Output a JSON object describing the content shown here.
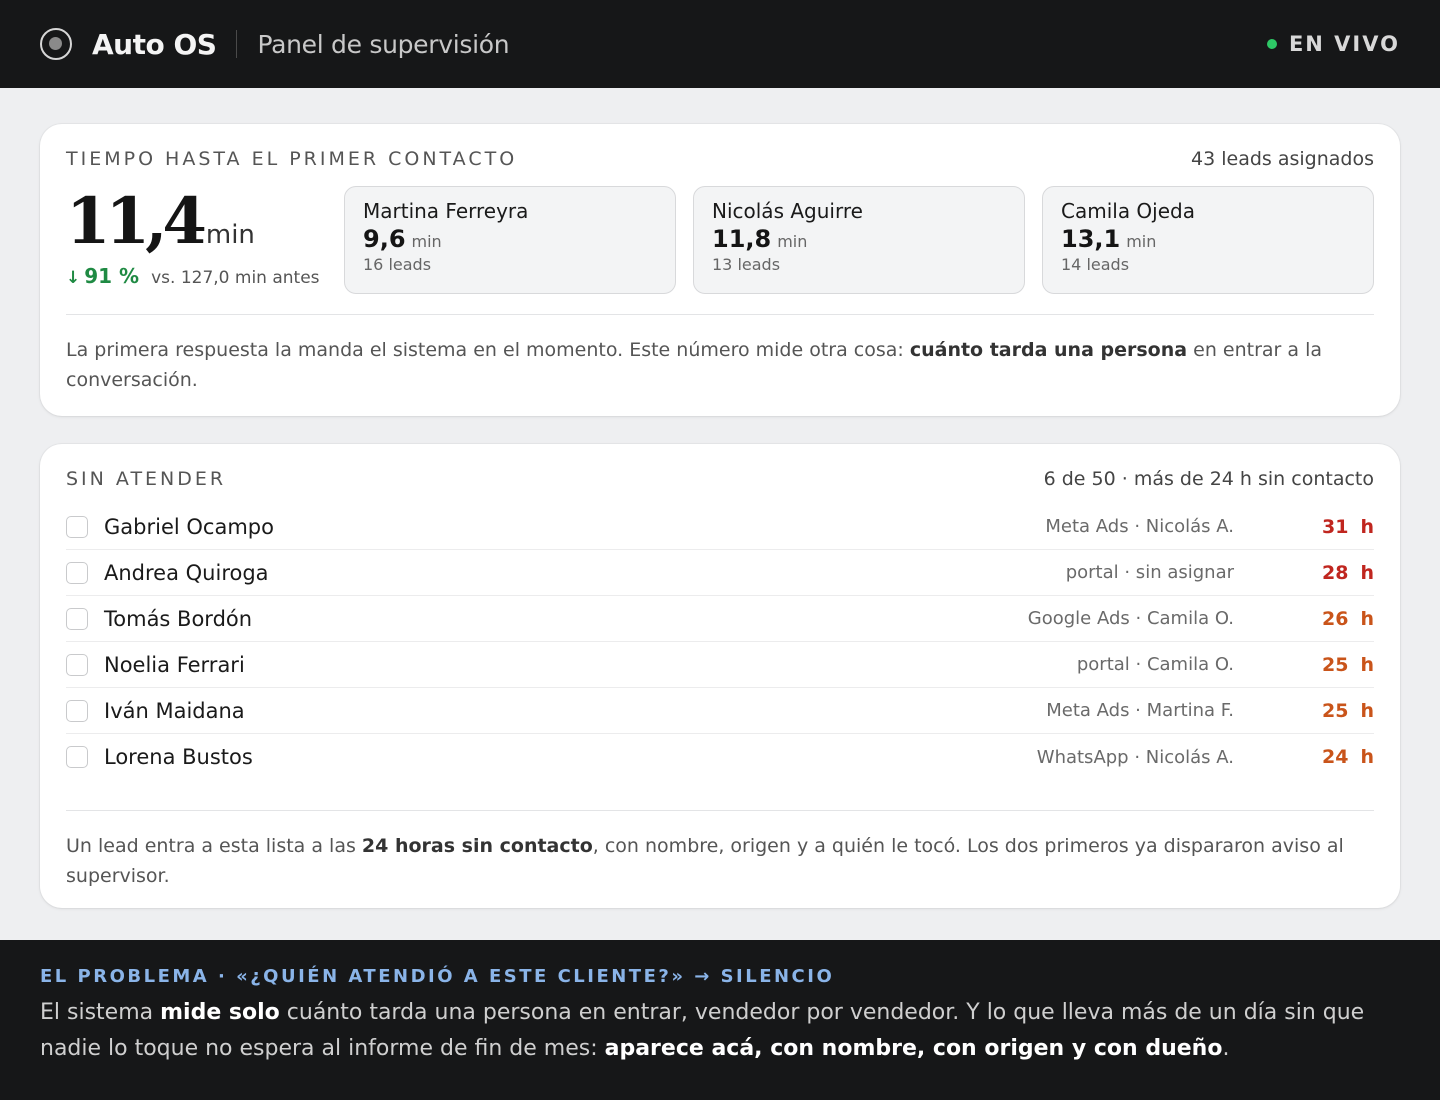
{
  "header": {
    "brand": "Auto OS",
    "subtitle": "Panel de supervisión",
    "status": "EN VIVO",
    "status_color": "#2ec866"
  },
  "first_contact": {
    "title": "TIEMPO HASTA EL PRIMER CONTACTO",
    "meta": "43 leads asignados",
    "kpi_value": "11,4",
    "kpi_unit": "min",
    "delta_arrow": "↓",
    "delta_value": "91 %",
    "delta_text": "vs. 127,0 min antes",
    "sellers": [
      {
        "name": "Martina Ferreyra",
        "time": "9,6",
        "unit": "min",
        "leads": "16 leads"
      },
      {
        "name": "Nicolás Aguirre",
        "time": "11,8",
        "unit": "min",
        "leads": "13 leads"
      },
      {
        "name": "Camila Ojeda",
        "time": "13,1",
        "unit": "min",
        "leads": "14 leads"
      }
    ],
    "note_before": "La primera respuesta la manda el sistema en el momento. Este número mide otra cosa: ",
    "note_bold": "cuánto tarda una persona",
    "note_after": " en entrar a la conversación."
  },
  "unattended": {
    "title": "SIN ATENDER",
    "meta": "6 de 50 · más de 24 h sin contacto",
    "unit": "h",
    "rows": [
      {
        "name": "Gabriel Ocampo",
        "source": "Meta Ads · Nicolás A.",
        "hours": "31",
        "color": "#c0261f"
      },
      {
        "name": "Andrea Quiroga",
        "source": "portal · sin asignar",
        "hours": "28",
        "color": "#c0261f"
      },
      {
        "name": "Tomás Bordón",
        "source": "Google Ads · Camila O.",
        "hours": "26",
        "color": "#c9541a"
      },
      {
        "name": "Noelia Ferrari",
        "source": "portal · Camila O.",
        "hours": "25",
        "color": "#c9541a"
      },
      {
        "name": "Iván Maidana",
        "source": "Meta Ads · Martina F.",
        "hours": "25",
        "color": "#c9541a"
      },
      {
        "name": "Lorena Bustos",
        "source": "WhatsApp · Nicolás A.",
        "hours": "24",
        "color": "#c9541a"
      }
    ],
    "note_before": "Un lead entra a esta lista a las ",
    "note_bold": "24 horas sin contacto",
    "note_after": ", con nombre, origen y a quién le tocó. Los dos primeros ya dispararon aviso al supervisor."
  },
  "problem": {
    "title": "EL PROBLEMA · «¿QUIÉN ATENDIÓ A ESTE CLIENTE?» → SILENCIO",
    "text_1": "El sistema ",
    "text_bold_1": "mide solo",
    "text_2": " cuánto tarda una persona en entrar, vendedor por vendedor. Y lo que lleva más de un día sin que nadie lo toque no espera al informe de fin de mes: ",
    "text_bold_2": "aparece acá, con nombre, con origen y con dueño",
    "text_3": "."
  }
}
